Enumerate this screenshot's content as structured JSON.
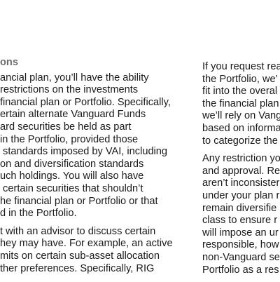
{
  "left_column": {
    "heading": "ons",
    "paragraphs": [
      {
        "lines": [
          "ancial plan, you’ll have the ability",
          "restrictions on the investments",
          "financial plan or Portfolio. Specifically,",
          "ertain alternate Vanguard Funds",
          "ard securities be held as part",
          "in the Portfolio, provided those",
          " standards imposed by VAI, including",
          "on and diversification standards",
          "uch holdings. You will also have",
          " certain securities that shouldn’t",
          "he financial plan or Portfolio or that",
          "d in the Portfolio."
        ]
      },
      {
        "lines": [
          "t with an advisor to discuss certain",
          "hey may have. For example, an active",
          "mits on certain sub-asset allocation",
          "ther preferences. Specifically, RIG"
        ]
      }
    ]
  },
  "right_column": {
    "paragraphs": [
      {
        "lines": [
          "If you request rea",
          "the Portfolio, we’",
          "fit into the overal",
          "the financial plan",
          "we’ll rely on Vang",
          "based on informa",
          "to categorize the"
        ]
      },
      {
        "lines": [
          "Any restriction yo",
          "and approval. Re",
          "aren’t inconsister",
          "under your plan r",
          "remain diversifie",
          "class to ensure r",
          "will impose an ur",
          "responsible, how",
          "non-Vanguard se",
          "Portfolio as a res"
        ]
      }
    ]
  }
}
